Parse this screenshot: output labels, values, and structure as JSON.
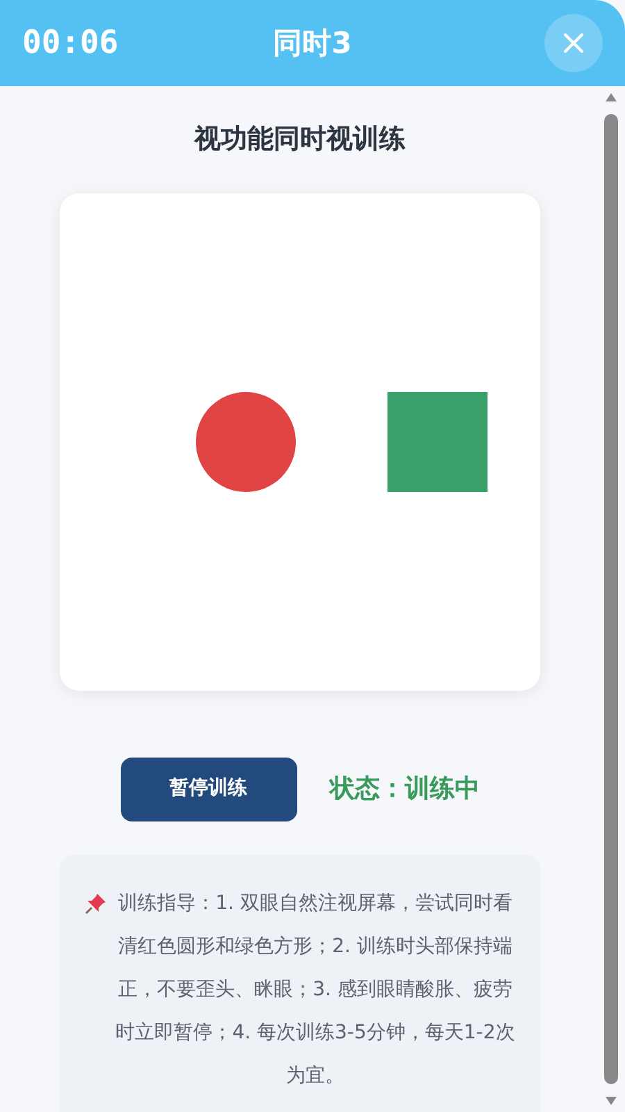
{
  "header": {
    "timer": "00:06",
    "title": "同时3"
  },
  "page_title": "视功能同时视训练",
  "stimulus": {
    "shapes": [
      {
        "kind": "circle",
        "color": "#e04444"
      },
      {
        "kind": "square",
        "color": "#3aa06a"
      }
    ]
  },
  "controls": {
    "pause_button": "暂停训练",
    "status": "状态：训练中"
  },
  "guide": {
    "text": "训练指导：1. 双眼自然注视屏幕，尝试同时看清红色圆形和绿色方形；2. 训练时头部保持端正，不要歪头、眯眼；3. 感到眼睛酸胀、疲劳时立即暂停；4. 每次训练3-5分钟，每天1-2次为宜。"
  }
}
